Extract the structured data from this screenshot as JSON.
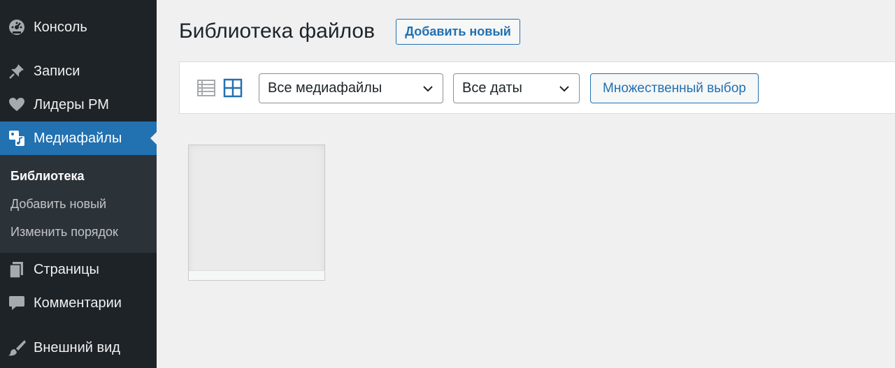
{
  "sidebar": {
    "items": [
      {
        "label": "Консоль",
        "icon": "dashboard-icon"
      },
      {
        "label": "Записи",
        "icon": "pin-icon"
      },
      {
        "label": "Лидеры РМ",
        "icon": "heart-icon"
      },
      {
        "label": "Медиафайлы",
        "icon": "media-icon",
        "active": true
      },
      {
        "label": "Страницы",
        "icon": "pages-icon"
      },
      {
        "label": "Комментарии",
        "icon": "comment-icon"
      },
      {
        "label": "Внешний вид",
        "icon": "brush-icon"
      }
    ],
    "submenu": [
      {
        "label": "Библиотека",
        "current": true
      },
      {
        "label": "Добавить новый"
      },
      {
        "label": "Изменить порядок"
      }
    ],
    "colors": {
      "background": "#1d2327",
      "active": "#2271b1",
      "submenu": "#2c3338"
    }
  },
  "header": {
    "title": "Библиотека файлов",
    "add_new_label": "Добавить новый"
  },
  "toolbar": {
    "view_modes": [
      "list-view-icon",
      "grid-view-icon"
    ],
    "active_view": "grid",
    "type_filter": {
      "selected": "Все медиафайлы"
    },
    "date_filter": {
      "selected": "Все даты"
    },
    "bulk_select_label": "Множественный выбор"
  },
  "attachments": [
    {
      "kind": "placeholder"
    }
  ],
  "colors": {
    "accent": "#2271b1",
    "page_bg": "#f0f0f1"
  }
}
